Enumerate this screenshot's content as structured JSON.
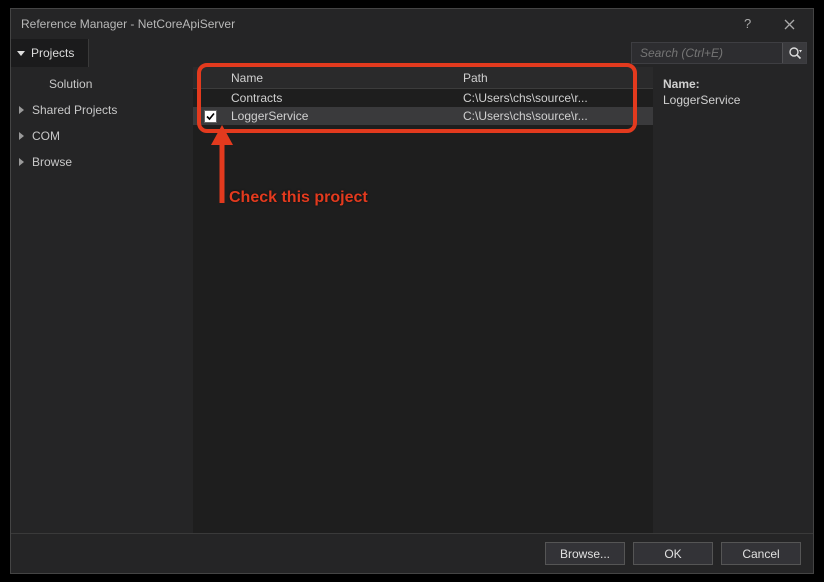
{
  "window": {
    "title": "Reference Manager - NetCoreApiServer"
  },
  "tabs": {
    "active": "Projects"
  },
  "search": {
    "placeholder": "Search (Ctrl+E)"
  },
  "sidebar": {
    "items": [
      {
        "label": "Solution",
        "sub": true
      },
      {
        "label": "Shared Projects"
      },
      {
        "label": "COM"
      },
      {
        "label": "Browse"
      }
    ]
  },
  "table": {
    "headers": {
      "name": "Name",
      "path": "Path"
    },
    "rows": [
      {
        "checked": false,
        "name": "Contracts",
        "path": "C:\\Users\\chs\\source\\r..."
      },
      {
        "checked": true,
        "name": "LoggerService",
        "path": "C:\\Users\\chs\\source\\r..."
      }
    ]
  },
  "details": {
    "label": "Name:",
    "value": "LoggerService"
  },
  "footer": {
    "browse": "Browse...",
    "ok": "OK",
    "cancel": "Cancel"
  },
  "annotation": {
    "text": "Check this project"
  }
}
